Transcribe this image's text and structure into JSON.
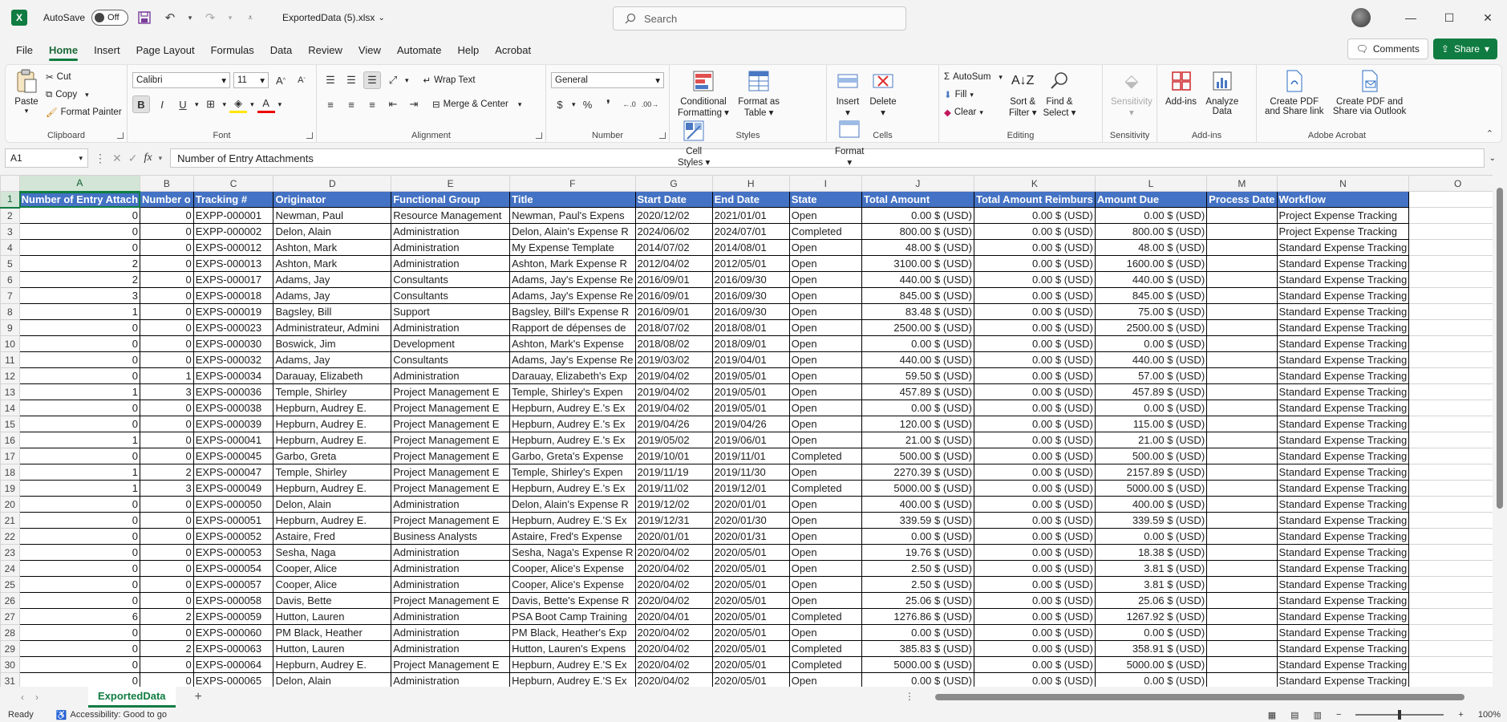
{
  "titlebar": {
    "autosave_label": "AutoSave",
    "autosave_state": "Off",
    "filename": "ExportedData (5).xlsx",
    "search_placeholder": "Search"
  },
  "menu": {
    "items": [
      "File",
      "Home",
      "Insert",
      "Page Layout",
      "Formulas",
      "Data",
      "Review",
      "View",
      "Automate",
      "Help",
      "Acrobat"
    ],
    "active": "Home",
    "comments_label": "Comments",
    "share_label": "Share"
  },
  "ribbon": {
    "clipboard": {
      "paste": "Paste",
      "cut": "Cut",
      "copy": "Copy",
      "format_painter": "Format Painter",
      "label": "Clipboard"
    },
    "font": {
      "name": "Calibri",
      "size": "11",
      "label": "Font"
    },
    "alignment": {
      "wrap_text": "Wrap Text",
      "merge_center": "Merge & Center",
      "label": "Alignment"
    },
    "number": {
      "format": "General",
      "label": "Number"
    },
    "styles": {
      "conditional": "Conditional",
      "conditional2": "Formatting",
      "format_table": "Format as",
      "format_table2": "Table",
      "cell_styles": "Cell",
      "cell_styles2": "Styles",
      "label": "Styles"
    },
    "cells": {
      "insert": "Insert",
      "delete": "Delete",
      "format": "Format",
      "label": "Cells"
    },
    "editing": {
      "autosum": "AutoSum",
      "fill": "Fill",
      "clear": "Clear",
      "sort_filter": "Sort &",
      "sort_filter2": "Filter",
      "find_select": "Find &",
      "find_select2": "Select",
      "label": "Editing"
    },
    "sensitivity": {
      "btn": "Sensitivity",
      "label": "Sensitivity"
    },
    "addins": {
      "btn": "Add-ins",
      "analyze": "Analyze",
      "analyze2": "Data",
      "label": "Add-ins"
    },
    "acrobat": {
      "pdf_share": "Create PDF",
      "pdf_share2": "and Share link",
      "pdf_outlook": "Create PDF and",
      "pdf_outlook2": "Share via Outlook",
      "label": "Adobe Acrobat"
    }
  },
  "formula_bar": {
    "name_box": "A1",
    "fx": "fx",
    "formula": "Number of Entry Attachments"
  },
  "sheet": {
    "columns": [
      "A",
      "B",
      "C",
      "D",
      "E",
      "F",
      "G",
      "H",
      "I",
      "J",
      "K",
      "L",
      "M",
      "N",
      "O"
    ],
    "header_row": [
      "Number of Entry Attach",
      "Number o",
      "Tracking #",
      "Originator",
      "Functional Group",
      "Title",
      "Start Date",
      "End Date",
      "State",
      "Total Amount",
      "Total Amount Reimburs",
      "Amount Due",
      "Process Date",
      "Workflow"
    ],
    "rows": [
      [
        "0",
        "0",
        "EXPP-000001",
        "Newman, Paul",
        "Resource Management",
        "Newman, Paul's Expens",
        "2020/12/02",
        "2021/01/01",
        "Open",
        "0.00 $ (USD)",
        "0.00 $ (USD)",
        "0.00 $ (USD)",
        "",
        "Project Expense Tracking"
      ],
      [
        "0",
        "0",
        "EXPP-000002",
        "Delon, Alain",
        "Administration",
        "Delon, Alain's Expense R",
        "2024/06/02",
        "2024/07/01",
        "Completed",
        "800.00 $ (USD)",
        "0.00 $ (USD)",
        "800.00 $ (USD)",
        "",
        "Project Expense Tracking"
      ],
      [
        "0",
        "0",
        "EXPS-000012",
        "Ashton, Mark",
        "Administration",
        "My Expense Template",
        "2014/07/02",
        "2014/08/01",
        "Open",
        "48.00 $ (USD)",
        "0.00 $ (USD)",
        "48.00 $ (USD)",
        "",
        "Standard Expense Tracking"
      ],
      [
        "2",
        "0",
        "EXPS-000013",
        "Ashton, Mark",
        "Administration",
        "Ashton, Mark Expense R",
        "2012/04/02",
        "2012/05/01",
        "Open",
        "3100.00 $ (USD)",
        "0.00 $ (USD)",
        "1600.00 $ (USD)",
        "",
        "Standard Expense Tracking"
      ],
      [
        "2",
        "0",
        "EXPS-000017",
        "Adams, Jay",
        "Consultants",
        "Adams, Jay's Expense Re",
        "2016/09/01",
        "2016/09/30",
        "Open",
        "440.00 $ (USD)",
        "0.00 $ (USD)",
        "440.00 $ (USD)",
        "",
        "Standard Expense Tracking"
      ],
      [
        "3",
        "0",
        "EXPS-000018",
        "Adams, Jay",
        "Consultants",
        "Adams, Jay's Expense Re",
        "2016/09/01",
        "2016/09/30",
        "Open",
        "845.00 $ (USD)",
        "0.00 $ (USD)",
        "845.00 $ (USD)",
        "",
        "Standard Expense Tracking"
      ],
      [
        "1",
        "0",
        "EXPS-000019",
        "Bagsley, Bill",
        "Support",
        "Bagsley, Bill's Expense R",
        "2016/09/01",
        "2016/09/30",
        "Open",
        "83.48 $ (USD)",
        "0.00 $ (USD)",
        "75.00 $ (USD)",
        "",
        "Standard Expense Tracking"
      ],
      [
        "0",
        "0",
        "EXPS-000023",
        "Administrateur, Admini",
        "Administration",
        "Rapport de dépenses de",
        "2018/07/02",
        "2018/08/01",
        "Open",
        "2500.00 $ (USD)",
        "0.00 $ (USD)",
        "2500.00 $ (USD)",
        "",
        "Standard Expense Tracking"
      ],
      [
        "0",
        "0",
        "EXPS-000030",
        "Boswick, Jim",
        "Development",
        "Ashton, Mark's Expense",
        "2018/08/02",
        "2018/09/01",
        "Open",
        "0.00 $ (USD)",
        "0.00 $ (USD)",
        "0.00 $ (USD)",
        "",
        "Standard Expense Tracking"
      ],
      [
        "0",
        "0",
        "EXPS-000032",
        "Adams, Jay",
        "Consultants",
        "Adams, Jay's Expense Re",
        "2019/03/02",
        "2019/04/01",
        "Open",
        "440.00 $ (USD)",
        "0.00 $ (USD)",
        "440.00 $ (USD)",
        "",
        "Standard Expense Tracking"
      ],
      [
        "0",
        "1",
        "EXPS-000034",
        "Darauay, Elizabeth",
        "Administration",
        "Darauay, Elizabeth's Exp",
        "2019/04/02",
        "2019/05/01",
        "Open",
        "59.50 $ (USD)",
        "0.00 $ (USD)",
        "57.00 $ (USD)",
        "",
        "Standard Expense Tracking"
      ],
      [
        "1",
        "3",
        "EXPS-000036",
        "Temple, Shirley",
        "Project Management E",
        "Temple, Shirley's Expen",
        "2019/04/02",
        "2019/05/01",
        "Open",
        "457.89 $ (USD)",
        "0.00 $ (USD)",
        "457.89 $ (USD)",
        "",
        "Standard Expense Tracking"
      ],
      [
        "0",
        "0",
        "EXPS-000038",
        "Hepburn, Audrey E.",
        "Project Management E",
        "Hepburn, Audrey E.'s Ex",
        "2019/04/02",
        "2019/05/01",
        "Open",
        "0.00 $ (USD)",
        "0.00 $ (USD)",
        "0.00 $ (USD)",
        "",
        "Standard Expense Tracking"
      ],
      [
        "0",
        "0",
        "EXPS-000039",
        "Hepburn, Audrey E.",
        "Project Management E",
        "Hepburn, Audrey E.'s Ex",
        "2019/04/26",
        "2019/04/26",
        "Open",
        "120.00 $ (USD)",
        "0.00 $ (USD)",
        "115.00 $ (USD)",
        "",
        "Standard Expense Tracking"
      ],
      [
        "1",
        "0",
        "EXPS-000041",
        "Hepburn, Audrey E.",
        "Project Management E",
        "Hepburn, Audrey E.'s Ex",
        "2019/05/02",
        "2019/06/01",
        "Open",
        "21.00 $ (USD)",
        "0.00 $ (USD)",
        "21.00 $ (USD)",
        "",
        "Standard Expense Tracking"
      ],
      [
        "0",
        "0",
        "EXPS-000045",
        "Garbo, Greta",
        "Project Management E",
        "Garbo, Greta's Expense",
        "2019/10/01",
        "2019/11/01",
        "Completed",
        "500.00 $ (USD)",
        "0.00 $ (USD)",
        "500.00 $ (USD)",
        "",
        "Standard Expense Tracking"
      ],
      [
        "1",
        "2",
        "EXPS-000047",
        "Temple, Shirley",
        "Project Management E",
        "Temple, Shirley's Expen",
        "2019/11/19",
        "2019/11/30",
        "Open",
        "2270.39 $ (USD)",
        "0.00 $ (USD)",
        "2157.89 $ (USD)",
        "",
        "Standard Expense Tracking"
      ],
      [
        "1",
        "3",
        "EXPS-000049",
        "Hepburn, Audrey E.",
        "Project Management E",
        "Hepburn, Audrey E.'s Ex",
        "2019/11/02",
        "2019/12/01",
        "Completed",
        "5000.00 $ (USD)",
        "0.00 $ (USD)",
        "5000.00 $ (USD)",
        "",
        "Standard Expense Tracking"
      ],
      [
        "0",
        "0",
        "EXPS-000050",
        "Delon, Alain",
        "Administration",
        "Delon, Alain's Expense R",
        "2019/12/02",
        "2020/01/01",
        "Open",
        "400.00 $ (USD)",
        "0.00 $ (USD)",
        "400.00 $ (USD)",
        "",
        "Standard Expense Tracking"
      ],
      [
        "0",
        "0",
        "EXPS-000051",
        "Hepburn, Audrey E.",
        "Project Management E",
        "Hepburn, Audrey E.'S Ex",
        "2019/12/31",
        "2020/01/30",
        "Open",
        "339.59 $ (USD)",
        "0.00 $ (USD)",
        "339.59 $ (USD)",
        "",
        "Standard Expense Tracking"
      ],
      [
        "0",
        "0",
        "EXPS-000052",
        "Astaire, Fred",
        "Business Analysts",
        "Astaire, Fred's Expense",
        "2020/01/01",
        "2020/01/31",
        "Open",
        "0.00 $ (USD)",
        "0.00 $ (USD)",
        "0.00 $ (USD)",
        "",
        "Standard Expense Tracking"
      ],
      [
        "0",
        "0",
        "EXPS-000053",
        "Sesha, Naga",
        "Administration",
        "Sesha, Naga's Expense R",
        "2020/04/02",
        "2020/05/01",
        "Open",
        "19.76 $ (USD)",
        "0.00 $ (USD)",
        "18.38 $ (USD)",
        "",
        "Standard Expense Tracking"
      ],
      [
        "0",
        "0",
        "EXPS-000054",
        "Cooper, Alice",
        "Administration",
        "Cooper, Alice's Expense",
        "2020/04/02",
        "2020/05/01",
        "Open",
        "2.50 $ (USD)",
        "0.00 $ (USD)",
        "3.81 $ (USD)",
        "",
        "Standard Expense Tracking"
      ],
      [
        "0",
        "0",
        "EXPS-000057",
        "Cooper, Alice",
        "Administration",
        "Cooper, Alice's Expense",
        "2020/04/02",
        "2020/05/01",
        "Open",
        "2.50 $ (USD)",
        "0.00 $ (USD)",
        "3.81 $ (USD)",
        "",
        "Standard Expense Tracking"
      ],
      [
        "0",
        "0",
        "EXPS-000058",
        "Davis, Bette",
        "Project Management E",
        "Davis, Bette's Expense R",
        "2020/04/02",
        "2020/05/01",
        "Open",
        "25.06 $ (USD)",
        "0.00 $ (USD)",
        "25.06 $ (USD)",
        "",
        "Standard Expense Tracking"
      ],
      [
        "6",
        "2",
        "EXPS-000059",
        "Hutton, Lauren",
        "Administration",
        "PSA Boot Camp Training",
        "2020/04/01",
        "2020/05/01",
        "Completed",
        "1276.86 $ (USD)",
        "0.00 $ (USD)",
        "1267.92 $ (USD)",
        "",
        "Standard Expense Tracking"
      ],
      [
        "0",
        "0",
        "EXPS-000060",
        "PM Black, Heather",
        "Administration",
        "PM Black, Heather's Exp",
        "2020/04/02",
        "2020/05/01",
        "Open",
        "0.00 $ (USD)",
        "0.00 $ (USD)",
        "0.00 $ (USD)",
        "",
        "Standard Expense Tracking"
      ],
      [
        "0",
        "2",
        "EXPS-000063",
        "Hutton, Lauren",
        "Administration",
        "Hutton, Lauren's Expens",
        "2020/04/02",
        "2020/05/01",
        "Completed",
        "385.83 $ (USD)",
        "0.00 $ (USD)",
        "358.91 $ (USD)",
        "",
        "Standard Expense Tracking"
      ],
      [
        "0",
        "0",
        "EXPS-000064",
        "Hepburn, Audrey E.",
        "Project Management E",
        "Hepburn, Audrey E.'S Ex",
        "2020/04/02",
        "2020/05/01",
        "Completed",
        "5000.00 $ (USD)",
        "0.00 $ (USD)",
        "5000.00 $ (USD)",
        "",
        "Standard Expense Tracking"
      ],
      [
        "0",
        "0",
        "EXPS-000065",
        "Delon, Alain",
        "Administration",
        "Hepburn, Audrey E.'S Ex",
        "2020/04/02",
        "2020/05/01",
        "Open",
        "0.00 $ (USD)",
        "0.00 $ (USD)",
        "0.00 $ (USD)",
        "",
        "Standard Expense Tracking"
      ]
    ]
  },
  "sheet_tabs": {
    "active": "ExportedData"
  },
  "status": {
    "ready": "Ready",
    "accessibility": "Accessibility: Good to go",
    "zoom": "100%"
  }
}
